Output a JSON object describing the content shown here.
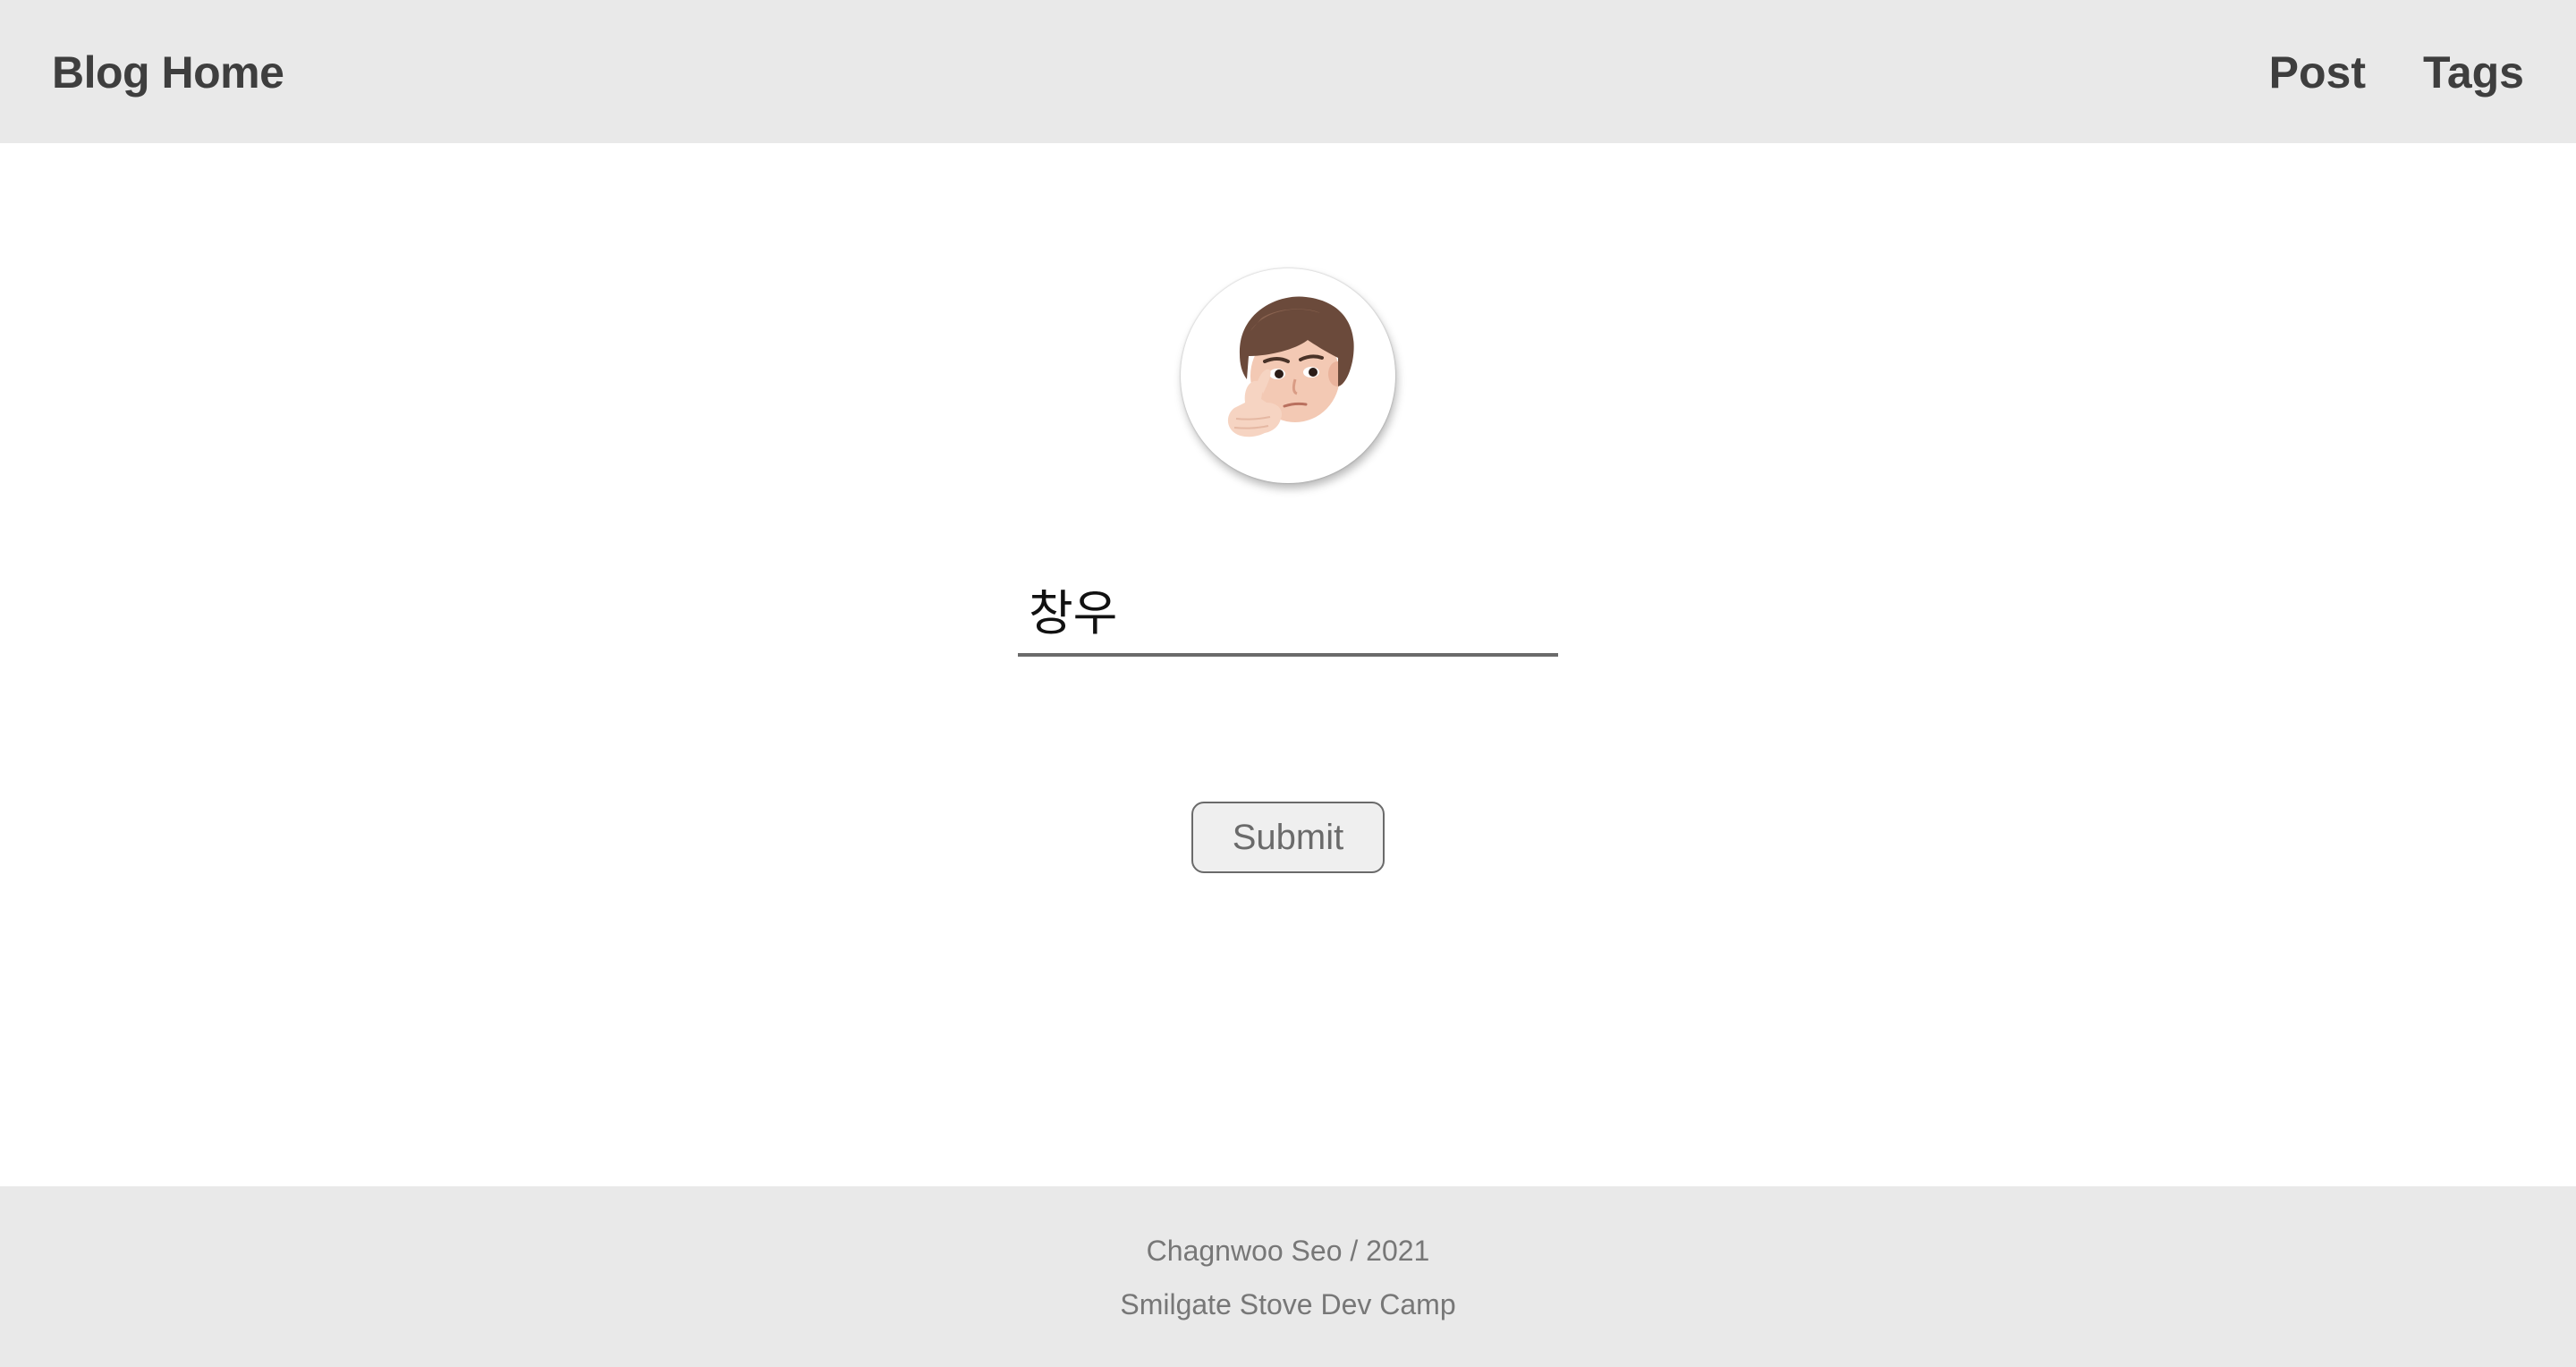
{
  "header": {
    "brand": "Blog Home",
    "nav": [
      {
        "label": "Post"
      },
      {
        "label": "Tags"
      }
    ]
  },
  "profile": {
    "avatar_icon": "memoji-thinking-avatar"
  },
  "form": {
    "name_value": "창우",
    "submit_label": "Submit"
  },
  "footer": {
    "line1": "Chagnwoo Seo / 2021",
    "line2": "Smilgate Stove Dev Camp"
  },
  "colors": {
    "bar_background": "#e9e9e9",
    "text_dark": "#3e3e3e",
    "text_muted": "#777777"
  }
}
